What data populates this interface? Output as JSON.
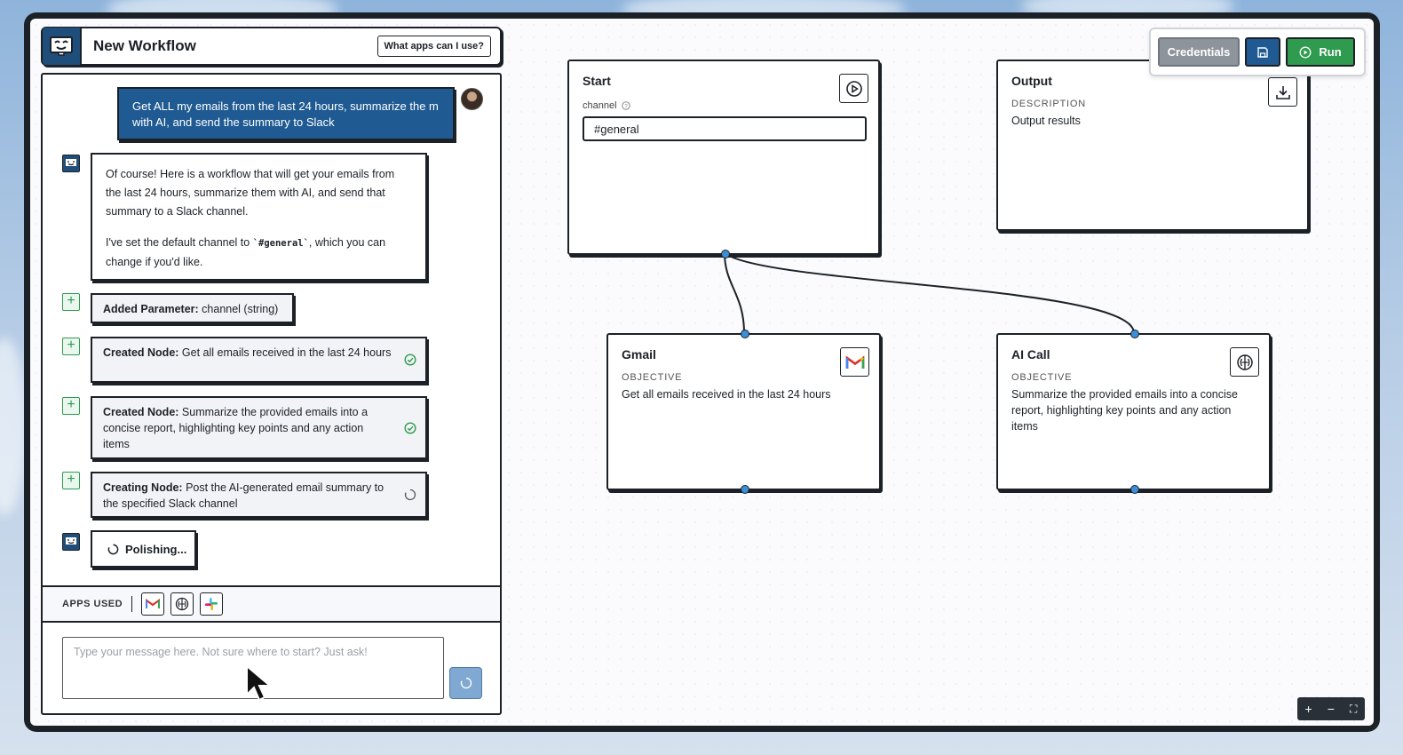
{
  "header": {
    "title": "New Workflow",
    "help_button": "What apps can I use?"
  },
  "chat": {
    "user_message": "Get ALL my emails from the last 24 hours, summarize the m with AI, and send the summary to Slack",
    "bot_message": {
      "para1": "Of course! Here is a workflow that will get your emails from the last 24 hours, summarize them with AI, and send that summary to a Slack channel.",
      "para2_before": "I've set the default channel to ",
      "para2_code": "`#general`",
      "para2_after": ", which you can change if you'd like."
    },
    "steps": [
      {
        "label": "Added Parameter:",
        "text": " channel (string)",
        "status": "none"
      },
      {
        "label": "Created Node:",
        "text": " Get all emails received in the last 24 hours",
        "status": "done"
      },
      {
        "label": "Created Node:",
        "text": " Summarize the provided emails into a concise report, highlighting key points and any action items",
        "status": "done"
      },
      {
        "label": "Creating Node:",
        "text": " Post the AI-generated email summary to the specified Slack channel",
        "status": "loading"
      }
    ],
    "polishing": "Polishing...",
    "apps_used_label": "APPS USED",
    "apps": [
      "gmail-icon",
      "ai-brain-icon",
      "slack-icon"
    ],
    "input_placeholder": "Type your message here. Not sure where to start? Just ask!"
  },
  "toolbar": {
    "credentials": "Credentials",
    "run": "Run"
  },
  "nodes": {
    "start": {
      "title": "Start",
      "param_label": "channel",
      "param_value": "#general"
    },
    "output": {
      "title": "Output",
      "label": "DESCRIPTION",
      "text": "Output results"
    },
    "gmail": {
      "title": "Gmail",
      "label": "OBJECTIVE",
      "text": "Get all emails received in the last 24 hours"
    },
    "ai_call": {
      "title": "AI Call",
      "label": "OBJECTIVE",
      "text": "Summarize the provided emails into a concise report, highlighting key points and any action items"
    }
  },
  "zoom": {
    "plus": "+",
    "minus": "−",
    "fit": "⛶"
  },
  "colors": {
    "brand_blue": "#1f5a92",
    "run_green": "#2f9b4f",
    "credentials_gray": "#8e949b",
    "port_blue": "#3a8fd8"
  }
}
